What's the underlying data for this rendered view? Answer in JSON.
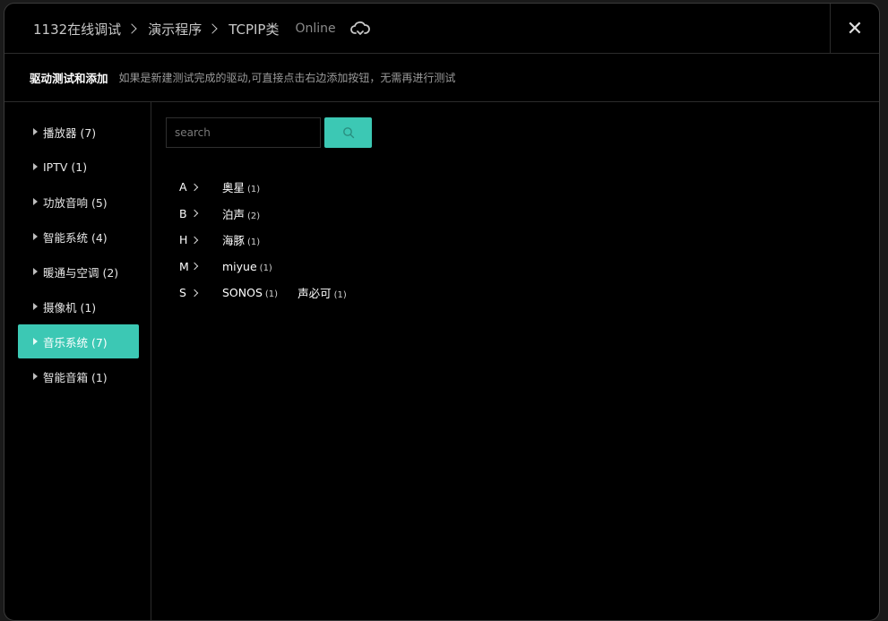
{
  "header": {
    "breadcrumbs": [
      "1132在线调试",
      "演示程序",
      "TCPIP类"
    ],
    "status": "Online",
    "close_label": "✕"
  },
  "desc": {
    "title": "驱动测试和添加",
    "text": "如果是新建测试完成的驱动,可直接点击右边添加按钮，无需再进行测试"
  },
  "sidebar": {
    "items": [
      {
        "label": "播放器 (7)"
      },
      {
        "label": "IPTV (1)"
      },
      {
        "label": "功放音响 (5)"
      },
      {
        "label": "智能系统 (4)"
      },
      {
        "label": "暖通与空调 (2)"
      },
      {
        "label": "摄像机 (1)"
      },
      {
        "label": "音乐系统 (7)"
      },
      {
        "label": "智能音箱 (1)"
      }
    ],
    "active_index": 6
  },
  "search": {
    "placeholder": "search",
    "value": ""
  },
  "brands": [
    {
      "letter": "A",
      "items": [
        {
          "name": "奥星",
          "count": "(1)"
        }
      ]
    },
    {
      "letter": "B",
      "items": [
        {
          "name": "泊声",
          "count": "(2)"
        }
      ]
    },
    {
      "letter": "H",
      "items": [
        {
          "name": "海豚",
          "count": "(1)"
        }
      ]
    },
    {
      "letter": "M",
      "items": [
        {
          "name": "miyue",
          "count": "(1)"
        }
      ]
    },
    {
      "letter": "S",
      "items": [
        {
          "name": "SONOS",
          "count": "(1)"
        },
        {
          "name": "声必可",
          "count": "(1)"
        }
      ]
    }
  ],
  "colors": {
    "accent": "#3cc8b4",
    "background": "#000000",
    "border": "#2b2b2b"
  },
  "icons": {
    "status": "cloud-refresh-icon",
    "search": "search-icon",
    "close": "close-icon"
  }
}
